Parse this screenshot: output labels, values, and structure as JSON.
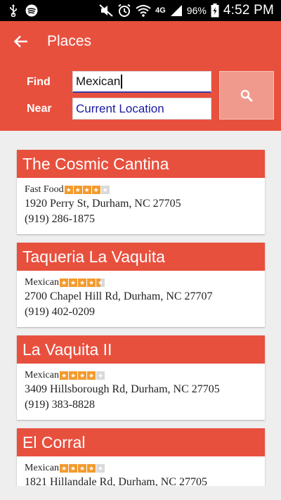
{
  "status": {
    "time": "4:52 PM",
    "battery": "96%",
    "network": "4G",
    "icons": [
      "usb-icon",
      "spotify-icon",
      "mute-icon",
      "alarm-icon",
      "wifi-icon",
      "signal-icon",
      "battery-icon"
    ]
  },
  "appbar": {
    "title": "Places",
    "back_icon": "back-arrow-icon"
  },
  "search": {
    "find_label": "Find",
    "near_label": "Near",
    "find_value": "Mexican",
    "near_value": "Current Location",
    "button_icon": "search-icon"
  },
  "results": [
    {
      "name": "The Cosmic Cantina",
      "category": "Fast Food",
      "rating": 4,
      "max_rating": 5,
      "address": "1920 Perry St, Durham, NC 27705",
      "phone": "(919) 286-1875"
    },
    {
      "name": "Taqueria La Vaquita",
      "category": "Mexican",
      "rating": 4.5,
      "max_rating": 5,
      "address": "2700 Chapel Hill Rd, Durham, NC 27707",
      "phone": "(919) 402-0209"
    },
    {
      "name": "La Vaquita II",
      "category": "Mexican",
      "rating": 4,
      "max_rating": 5,
      "address": "3409 Hillsborough Rd, Durham, NC 27705",
      "phone": "(919) 383-8828"
    },
    {
      "name": "El Corral",
      "category": "Mexican",
      "rating": 4,
      "max_rating": 5,
      "address": "1821 Hillandale Rd, Durham, NC 27705",
      "phone": ""
    }
  ],
  "colors": {
    "accent": "#e8503e",
    "star": "#f39a2e",
    "star_empty": "#d9d9d9",
    "search_button": "#f09a8d"
  }
}
